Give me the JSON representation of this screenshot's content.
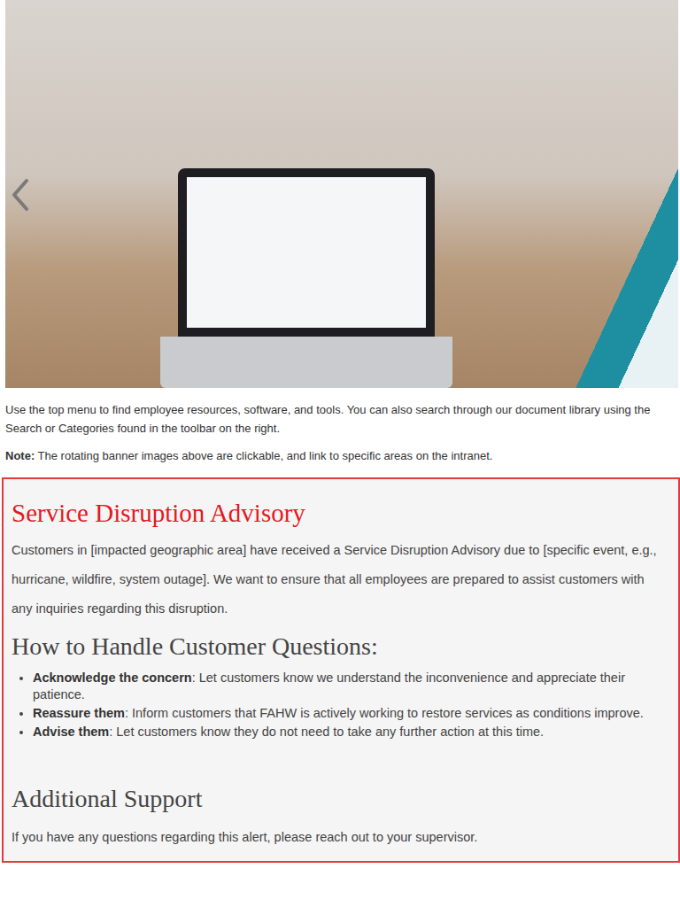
{
  "intro": {
    "text": "Use the top menu to find employee resources, software, and tools. You can also search through our document library using the Search or Categories found in the toolbar on the right.",
    "note_label": "Note:",
    "note_text": " The rotating banner images above are clickable, and link to specific areas on the intranet."
  },
  "advisory": {
    "title": "Service Disruption Advisory",
    "body": "Customers in [impacted geographic area] have received a Service Disruption Advisory due to [specific event, e.g., hurricane, wildfire, system outage]. We want to ensure that all employees are prepared to assist customers with any inquiries regarding this disruption.",
    "handling_title": "How to Handle Customer Questions:",
    "items": [
      {
        "label": "Acknowledge the concern",
        "text": ": Let customers know we understand the inconvenience and appreciate their patience."
      },
      {
        "label": "Reassure them",
        "text": ": Inform customers that FAHW is actively working to restore services as conditions improve."
      },
      {
        "label": "Advise them",
        "text": ": Let customers know they do not need to take any further action at this time."
      }
    ],
    "support_title": "Additional Support",
    "support_text": "If you have any questions regarding this alert, please reach out to your supervisor."
  }
}
